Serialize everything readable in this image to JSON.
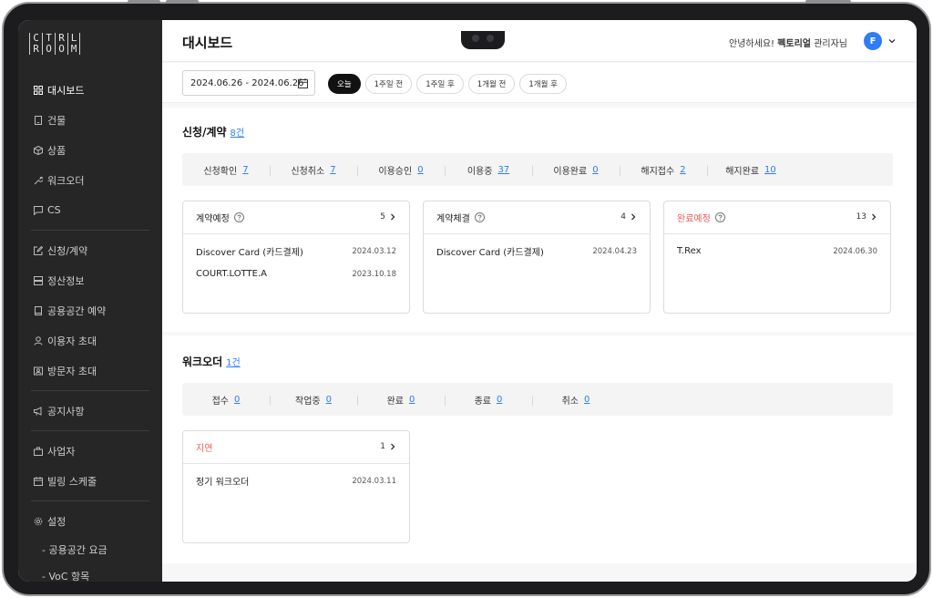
{
  "logo": {
    "letters": [
      "C",
      "T",
      "R",
      "L",
      "R",
      "O",
      "O",
      "M"
    ]
  },
  "sidebar": {
    "items": [
      {
        "label": "대시보드",
        "icon": "grid-icon"
      },
      {
        "label": "건물",
        "icon": "building-icon"
      },
      {
        "label": "상품",
        "icon": "box-icon"
      },
      {
        "label": "워크오더",
        "icon": "wrench-icon"
      },
      {
        "label": "CS",
        "icon": "chat-icon"
      },
      {
        "label": "신청/계약",
        "icon": "edit-icon"
      },
      {
        "label": "정산정보",
        "icon": "database-icon"
      },
      {
        "label": "공용공간 예약",
        "icon": "book-icon"
      },
      {
        "label": "이용자 초대",
        "icon": "user-icon"
      },
      {
        "label": "방문자 초대",
        "icon": "id-card-icon"
      },
      {
        "label": "공지사항",
        "icon": "megaphone-icon"
      },
      {
        "label": "사업자",
        "icon": "briefcase-icon"
      },
      {
        "label": "빌링 스케줄",
        "icon": "calendar-icon"
      },
      {
        "label": "설정",
        "icon": "gear-icon"
      }
    ],
    "subitems": [
      "- 공용공간 요금",
      "- VoC 항목"
    ]
  },
  "header": {
    "title": "대시보드",
    "greet_prefix": "안녕하세요! ",
    "user_name": "펙토리얼",
    "greet_suffix": " 관리자님",
    "avatar_letter": "F"
  },
  "filter": {
    "date_range": "2024.06.26 - 2024.06.26",
    "chips": [
      "오늘",
      "1주일 전",
      "1주일 후",
      "1개월 전",
      "1개월 후"
    ]
  },
  "contract": {
    "title": "신청/계약",
    "count": "8건",
    "stats": [
      {
        "label": "신청확인",
        "value": "7"
      },
      {
        "label": "신청취소",
        "value": "7"
      },
      {
        "label": "이용승인",
        "value": "0"
      },
      {
        "label": "이용중",
        "value": "37"
      },
      {
        "label": "이용완료",
        "value": "0"
      },
      {
        "label": "해지접수",
        "value": "2"
      },
      {
        "label": "해지완료",
        "value": "10"
      }
    ],
    "cards": [
      {
        "title": "계약예정",
        "count": "5",
        "rows": [
          {
            "name": "Discover Card (카드결제)",
            "date": "2024.03.12"
          },
          {
            "name": "COURT.LOTTE.A",
            "date": "2023.10.18"
          }
        ]
      },
      {
        "title": "계약체결",
        "count": "4",
        "rows": [
          {
            "name": "Discover Card (카드결제)",
            "date": "2024.04.23"
          }
        ]
      },
      {
        "title": "완료예정",
        "count": "13",
        "rows": [
          {
            "name": "T.Rex",
            "date": "2024.06.30"
          }
        ]
      }
    ]
  },
  "workorder": {
    "title": "워크오더",
    "count": "1건",
    "stats": [
      {
        "label": "접수",
        "value": "0"
      },
      {
        "label": "작업중",
        "value": "0"
      },
      {
        "label": "완료",
        "value": "0"
      },
      {
        "label": "종료",
        "value": "0"
      },
      {
        "label": "취소",
        "value": "0"
      }
    ],
    "cards": [
      {
        "title": "지연",
        "count": "1",
        "rows": [
          {
            "name": "정기 워크오더",
            "date": "2024.03.11"
          }
        ]
      }
    ]
  },
  "colors": {
    "accent": "#2e7cf6",
    "warning": "#ef5a5a",
    "sidebar_bg": "#262626"
  }
}
